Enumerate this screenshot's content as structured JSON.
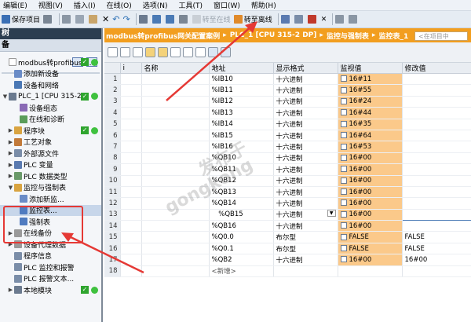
{
  "menubar": [
    "编辑(E)",
    "视图(V)",
    "插入(I)",
    "在线(O)",
    "选项(N)",
    "工具(T)",
    "窗口(W)",
    "帮助(H)"
  ],
  "toolbar": {
    "save": "保存项目",
    "go_online": "转至在线",
    "go_offline": "转至离线"
  },
  "left": {
    "header": "树",
    "subheader": "备",
    "tree": [
      {
        "label": "modbus转profibus网...",
        "indent": 0,
        "arrow": "",
        "ic": "#fff",
        "status": true
      },
      {
        "label": "添加新设备",
        "indent": 1,
        "arrow": "",
        "ic": "#6a8cc7"
      },
      {
        "label": "设备和网络",
        "indent": 1,
        "arrow": "",
        "ic": "#4a78b5"
      },
      {
        "label": "PLC_1 [CPU 315-2...",
        "indent": 0,
        "arrow": "▼",
        "ic": "#6b7a8f",
        "status": true
      },
      {
        "label": "设备组态",
        "indent": 2,
        "arrow": "",
        "ic": "#8a6ab5"
      },
      {
        "label": "在线和诊断",
        "indent": 2,
        "arrow": "",
        "ic": "#5a9c5a"
      },
      {
        "label": "程序块",
        "indent": 1,
        "arrow": "▶",
        "ic": "#d9a441",
        "status": true
      },
      {
        "label": "工艺对象",
        "indent": 1,
        "arrow": "▶",
        "ic": "#c27a3a"
      },
      {
        "label": "外部源文件",
        "indent": 1,
        "arrow": "▶",
        "ic": "#7a8da8"
      },
      {
        "label": "PLC 变量",
        "indent": 1,
        "arrow": "▶",
        "ic": "#5a7ab0"
      },
      {
        "label": "PLC 数据类型",
        "indent": 1,
        "arrow": "▶",
        "ic": "#6a9a6a"
      },
      {
        "label": "监控与强制表",
        "indent": 1,
        "arrow": "▼",
        "ic": "#d9a441"
      },
      {
        "label": "添加新监...",
        "indent": 2,
        "arrow": "",
        "ic": "#6a8cc7"
      },
      {
        "label": "监控表...",
        "indent": 2,
        "arrow": "",
        "ic": "#4f7bc0"
      },
      {
        "label": "强制表",
        "indent": 2,
        "arrow": "",
        "ic": "#4f7bc0"
      },
      {
        "label": "在线备份",
        "indent": 1,
        "arrow": "▶",
        "ic": "#9a9a9a"
      },
      {
        "label": "设备代理数据",
        "indent": 1,
        "arrow": "▶",
        "ic": "#9a9a9a"
      },
      {
        "label": "程序信息",
        "indent": 1,
        "arrow": "",
        "ic": "#7a8da8"
      },
      {
        "label": "PLC 监控和报警",
        "indent": 1,
        "arrow": "",
        "ic": "#7a8da8"
      },
      {
        "label": "PLC 报警文本...",
        "indent": 1,
        "arrow": "",
        "ic": "#7a8da8"
      },
      {
        "label": "本地模块",
        "indent": 1,
        "arrow": "▶",
        "ic": "#6b7a8f",
        "status": true
      }
    ]
  },
  "breadcrumb": [
    "modbus转profibus网关配置案例",
    "PLC_1 [CPU 315-2 DP]",
    "监控与强制表",
    "监控表_1"
  ],
  "search_placeholder": "<在项目中",
  "table": {
    "headers": [
      "",
      "i",
      "名称",
      "地址",
      "显示格式",
      "监视值",
      "修改值"
    ],
    "rows": [
      [
        "1",
        "",
        "",
        "%IB10",
        "十六进制",
        "16#11",
        ""
      ],
      [
        "2",
        "",
        "",
        "%IB11",
        "十六进制",
        "16#55",
        ""
      ],
      [
        "3",
        "",
        "",
        "%IB12",
        "十六进制",
        "16#24",
        ""
      ],
      [
        "4",
        "",
        "",
        "%IB13",
        "十六进制",
        "16#44",
        ""
      ],
      [
        "5",
        "",
        "",
        "%IB14",
        "十六进制",
        "16#35",
        ""
      ],
      [
        "6",
        "",
        "",
        "%IB15",
        "十六进制",
        "16#64",
        ""
      ],
      [
        "7",
        "",
        "",
        "%IB16",
        "十六进制",
        "16#53",
        ""
      ],
      [
        "8",
        "",
        "",
        "%QB10",
        "十六进制",
        "16#00",
        ""
      ],
      [
        "9",
        "",
        "",
        "%QB11",
        "十六进制",
        "16#00",
        ""
      ],
      [
        "10",
        "",
        "",
        "%QB12",
        "十六进制",
        "16#00",
        ""
      ],
      [
        "11",
        "",
        "",
        "%QB13",
        "十六进制",
        "16#00",
        ""
      ],
      [
        "12",
        "",
        "",
        "%QB14",
        "十六进制",
        "16#00",
        ""
      ],
      [
        "13",
        "",
        "",
        "%QB15",
        "十六进制",
        "16#00",
        ""
      ],
      [
        "14",
        "",
        "",
        "%QB16",
        "十六进制",
        "16#00",
        ""
      ],
      [
        "15",
        "",
        "",
        "%Q0.0",
        "布尔型",
        "FALSE",
        "FALSE"
      ],
      [
        "16",
        "",
        "",
        "%Q0.1",
        "布尔型",
        "FALSE",
        "FALSE"
      ],
      [
        "17",
        "",
        "",
        "%QB2",
        "十六进制",
        "16#00",
        "16#00"
      ],
      [
        "18",
        "",
        "",
        "<新增>",
        "",
        "",
        ""
      ]
    ]
  },
  "watermark": [
    "发布于",
    "gongkong"
  ]
}
